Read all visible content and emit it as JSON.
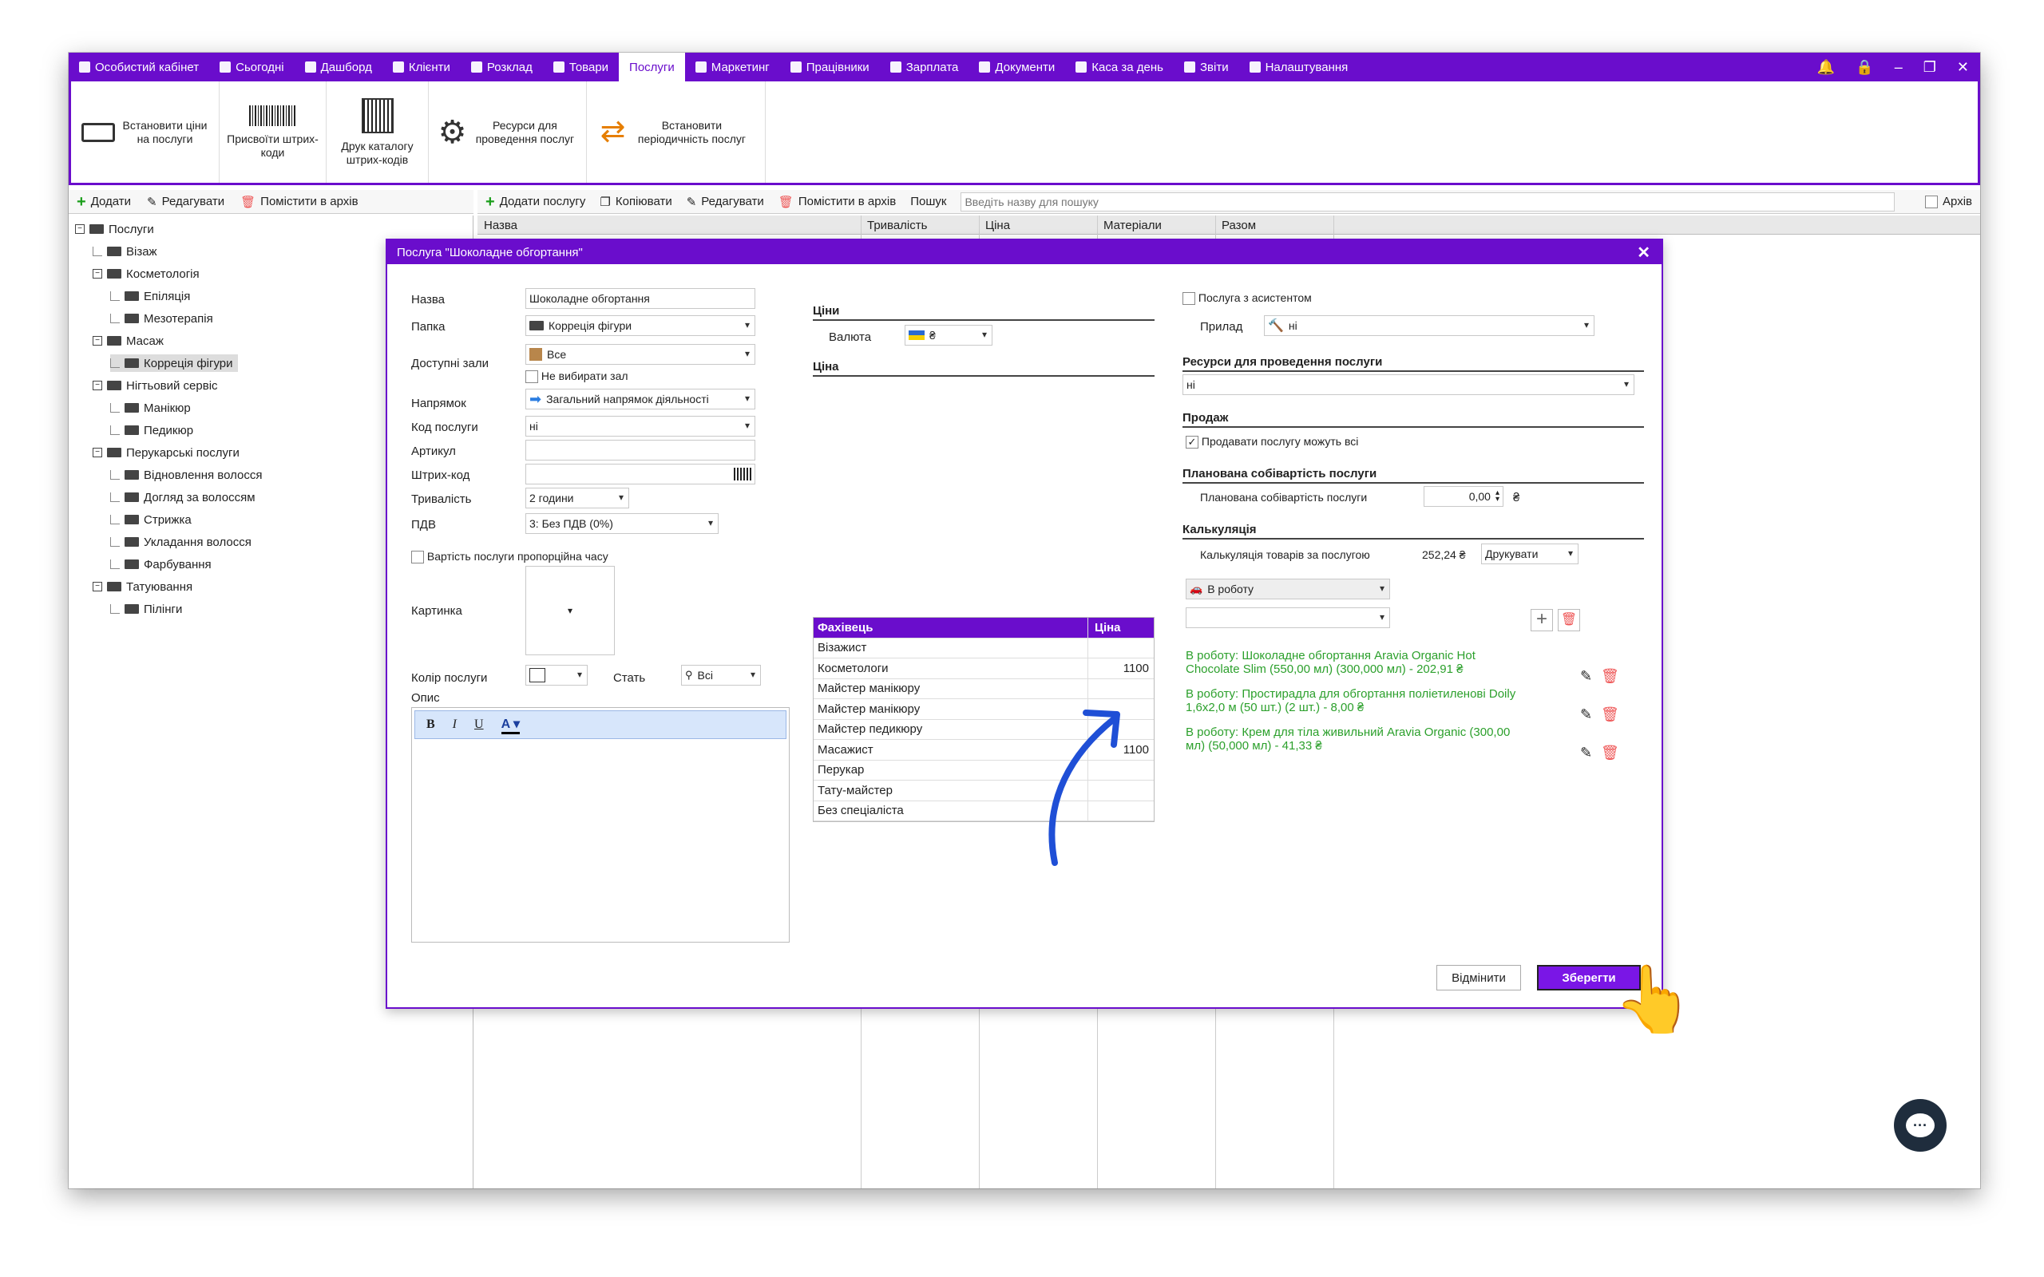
{
  "nav": {
    "tabs": [
      {
        "label": "Особистий кабінет",
        "icon": "briefcase-icon"
      },
      {
        "label": "Сьогодні",
        "icon": "clock-icon"
      },
      {
        "label": "Дашборд",
        "icon": "pulse-icon"
      },
      {
        "label": "Клієнти",
        "icon": "user-circle-icon"
      },
      {
        "label": "Розклад",
        "icon": "calendar-icon"
      },
      {
        "label": "Товари",
        "icon": "box-icon"
      },
      {
        "label": "Послуги",
        "icon": "",
        "active": true
      },
      {
        "label": "Маркетинг",
        "icon": "megaphone-icon"
      },
      {
        "label": "Працівники",
        "icon": "person-icon"
      },
      {
        "label": "Зарплата",
        "icon": "money-icon"
      },
      {
        "label": "Документи",
        "icon": "document-icon"
      },
      {
        "label": "Каса за день",
        "icon": "calculator-icon"
      },
      {
        "label": "Звіти",
        "icon": "bar-chart-icon"
      },
      {
        "label": "Налаштування",
        "icon": "gear-icon"
      }
    ],
    "accent": "#6a0dcc"
  },
  "ribbon": {
    "set_prices": "Встановити ціни на послуги",
    "assign_barcodes": "Присвоїти штрих-коди",
    "print_barcodes": "Друк каталогу штрих-кодів",
    "resources": "Ресурси для проведення послуг",
    "periodicity": "Встановити періодичність послуг"
  },
  "left_toolbar": {
    "add": "Додати",
    "edit": "Редагувати",
    "archive": "Помістити в архів"
  },
  "tree": [
    {
      "label": "Послуги",
      "level": 0,
      "expand": "−"
    },
    {
      "label": "Візаж",
      "level": 1
    },
    {
      "label": "Косметологія",
      "level": 1,
      "expand": "−"
    },
    {
      "label": "Епіляція",
      "level": 2
    },
    {
      "label": "Мезотерапія",
      "level": 2
    },
    {
      "label": "Масаж",
      "level": 1,
      "expand": "−"
    },
    {
      "label": "Корреція фігури",
      "level": 2,
      "selected": true
    },
    {
      "label": "Нігтьовий сервіс",
      "level": 1,
      "expand": "−"
    },
    {
      "label": "Манікюр",
      "level": 2
    },
    {
      "label": "Педикюр",
      "level": 2
    },
    {
      "label": "Перукарські послуги",
      "level": 1,
      "expand": "−"
    },
    {
      "label": "Відновлення волосся",
      "level": 2
    },
    {
      "label": "Догляд за волоссям",
      "level": 2
    },
    {
      "label": "Стрижка",
      "level": 2
    },
    {
      "label": "Укладання волосся",
      "level": 2
    },
    {
      "label": "Фарбування",
      "level": 2
    },
    {
      "label": "Татуювання",
      "level": 1,
      "expand": "−"
    },
    {
      "label": "Пілінги",
      "level": 2
    }
  ],
  "right_toolbar": {
    "add": "Додати послугу",
    "copy": "Копіювати",
    "edit": "Редагувати",
    "archive": "Помістити в архів",
    "search_label": "Пошук",
    "search_placeholder": "Введіть назву для пошуку",
    "archive_check": "Архів"
  },
  "grid_headers": [
    "Назва",
    "Тривалість",
    "Ціна",
    "Матеріали",
    "Разом"
  ],
  "dialog": {
    "title": "Послуга \"Шоколадне обгортання\"",
    "close": "✕",
    "fields": {
      "name_label": "Назва",
      "name_value": "Шоколадне обгортання",
      "folder_label": "Папка",
      "folder_value": "Корреція фігури",
      "halls_label": "Доступні зали",
      "halls_value": "Все",
      "no_hall": "Не вибирати зал",
      "direction_label": "Напрямок",
      "direction_value": "Загальний напрямок діяльності",
      "code_label": "Код послуги",
      "code_value": "ні",
      "article_label": "Артикул",
      "barcode_label": "Штрих-код",
      "duration_label": "Тривалість",
      "duration_value": "2 години",
      "vat_label": "ПДВ",
      "vat_value": "3: Без ПДВ (0%)",
      "proportional": "Вартість послуги пропорційна часу",
      "picture_label": "Картинка",
      "color_label": "Колір послуги",
      "gender_label": "Стать",
      "gender_value": "Всі",
      "desc_label": "Опис"
    },
    "prices": {
      "header": "Ціни",
      "currency_label": "Валюта",
      "currency_value": "₴",
      "price_header": "Ціна",
      "col_specialist": "Фахівець",
      "col_price": "Ціна",
      "rows": [
        {
          "name": "Візажист",
          "price": ""
        },
        {
          "name": "Косметологи",
          "price": "1100"
        },
        {
          "name": "Майстер манікюру",
          "price": ""
        },
        {
          "name": "Майстер манікюру",
          "price": ""
        },
        {
          "name": "Майстер педикюру",
          "price": ""
        },
        {
          "name": "Масажист",
          "price": "1100"
        },
        {
          "name": "Перукар",
          "price": ""
        },
        {
          "name": "Тату-майстер",
          "price": ""
        },
        {
          "name": "Без спеціаліста",
          "price": ""
        }
      ]
    },
    "right": {
      "assistant": "Послуга з асистентом",
      "device_label": "Прилад",
      "device_value": "ні",
      "resources_header": "Ресурси для проведення послуги",
      "resources_value": "ні",
      "sale_header": "Продаж",
      "sale_all": "Продавати послугу можуть всі",
      "cost_header": "Планована собівартість послуги",
      "cost_label": "Планована собівартість послуги",
      "cost_value": "0,00",
      "cost_currency": "₴",
      "calc_header": "Калькуляція",
      "calc_label": "Калькуляція товарів за послугою",
      "calc_value": "252,24 ₴",
      "print": "Друкувати",
      "to_work": "В роботу",
      "items": [
        "В роботу: Шоколадне обгортання Aravia Organic Hot Chocolate Slim (550,00 мл) (300,000 мл) - 202,91 ₴",
        "В роботу: Простирадла для обгортання поліетиленові Doily 1,6х2,0 м (50 шт.) (2 шт.) - 8,00 ₴",
        "В роботу: Крем для тіла живильний Aravia Organic (300,00 мл) (50,000 мл) - 41,33 ₴"
      ]
    },
    "cancel": "Відмінити",
    "save": "Зберегти"
  }
}
